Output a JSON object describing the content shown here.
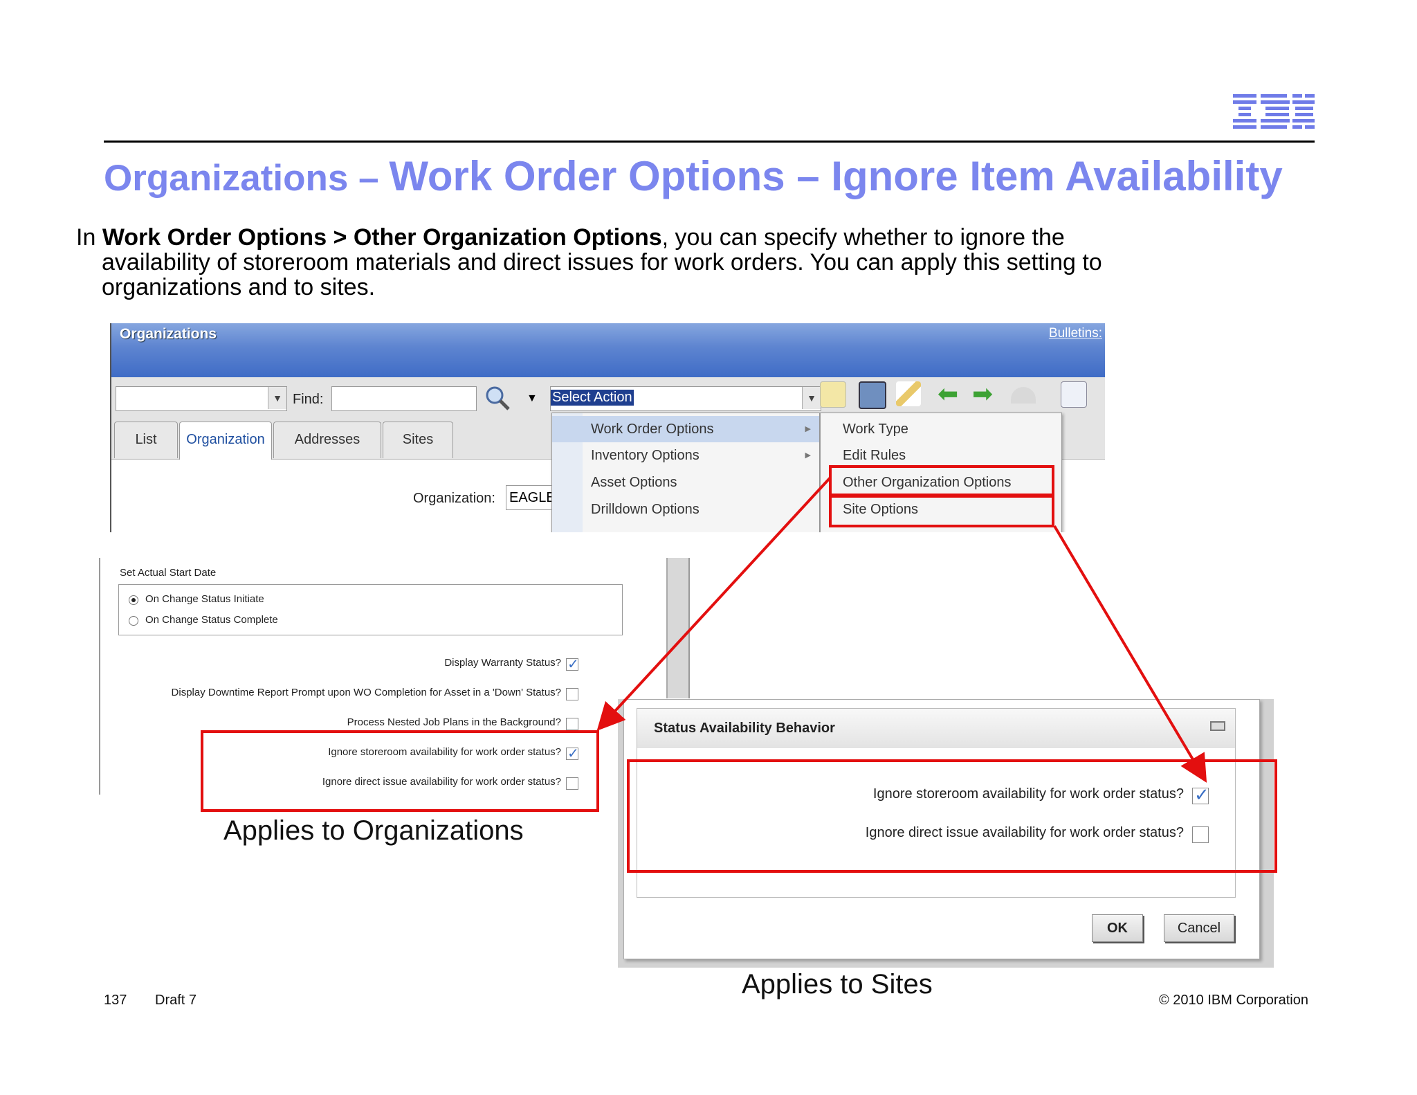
{
  "slide": {
    "title_part1": "Organizations – ",
    "title_part2": "Work Order Options – Ignore Item Availability",
    "intro_prefix": "In ",
    "intro_bold": "Work Order Options > Other Organization Options",
    "intro_line1_rest": ", you can specify whether to ignore the",
    "intro_line2": "availability of storeroom materials and direct issues for work orders. You can apply this setting to",
    "intro_line3": "organizations and to sites.",
    "page_number": "137",
    "draft": "Draft 7",
    "copyright": "© 2010 IBM Corporation",
    "logo_text": "IBM",
    "accent_color": "#7b86ee"
  },
  "app_screenshot": {
    "app_title": "Organizations",
    "bulletins": "Bulletins:",
    "find_label": "Find:",
    "select_action": "Select Action",
    "tabs": [
      "List",
      "Organization",
      "Addresses",
      "Sites"
    ],
    "organization_label": "Organization:",
    "organization_value": "EAGLE",
    "action_menu": [
      "Work Order Options",
      "Inventory Options",
      "Asset Options",
      "Drilldown Options"
    ],
    "submenu": [
      "Work Type",
      "Edit Rules",
      "Other Organization Options",
      "Site Options"
    ]
  },
  "org_panel": {
    "section_label": "Set Actual Start Date",
    "radio1": "On Change Status Initiate",
    "radio2": "On Change Status Complete",
    "check_warranty": "Display Warranty Status?",
    "check_downtime": "Display Downtime Report Prompt upon WO Completion for Asset in a 'Down' Status?",
    "check_nested": "Process Nested Job Plans in the Background?",
    "check_storeroom": "Ignore storeroom availability for work order status?",
    "check_direct": "Ignore direct issue availability for work order status?",
    "caption": "Applies to Organizations"
  },
  "site_dialog": {
    "section_title": "Status Availability Behavior",
    "check_storeroom": "Ignore storeroom availability for work order status?",
    "check_direct": "Ignore direct issue availability for work order status?",
    "ok": "OK",
    "cancel": "Cancel",
    "caption": "Applies to Sites"
  }
}
